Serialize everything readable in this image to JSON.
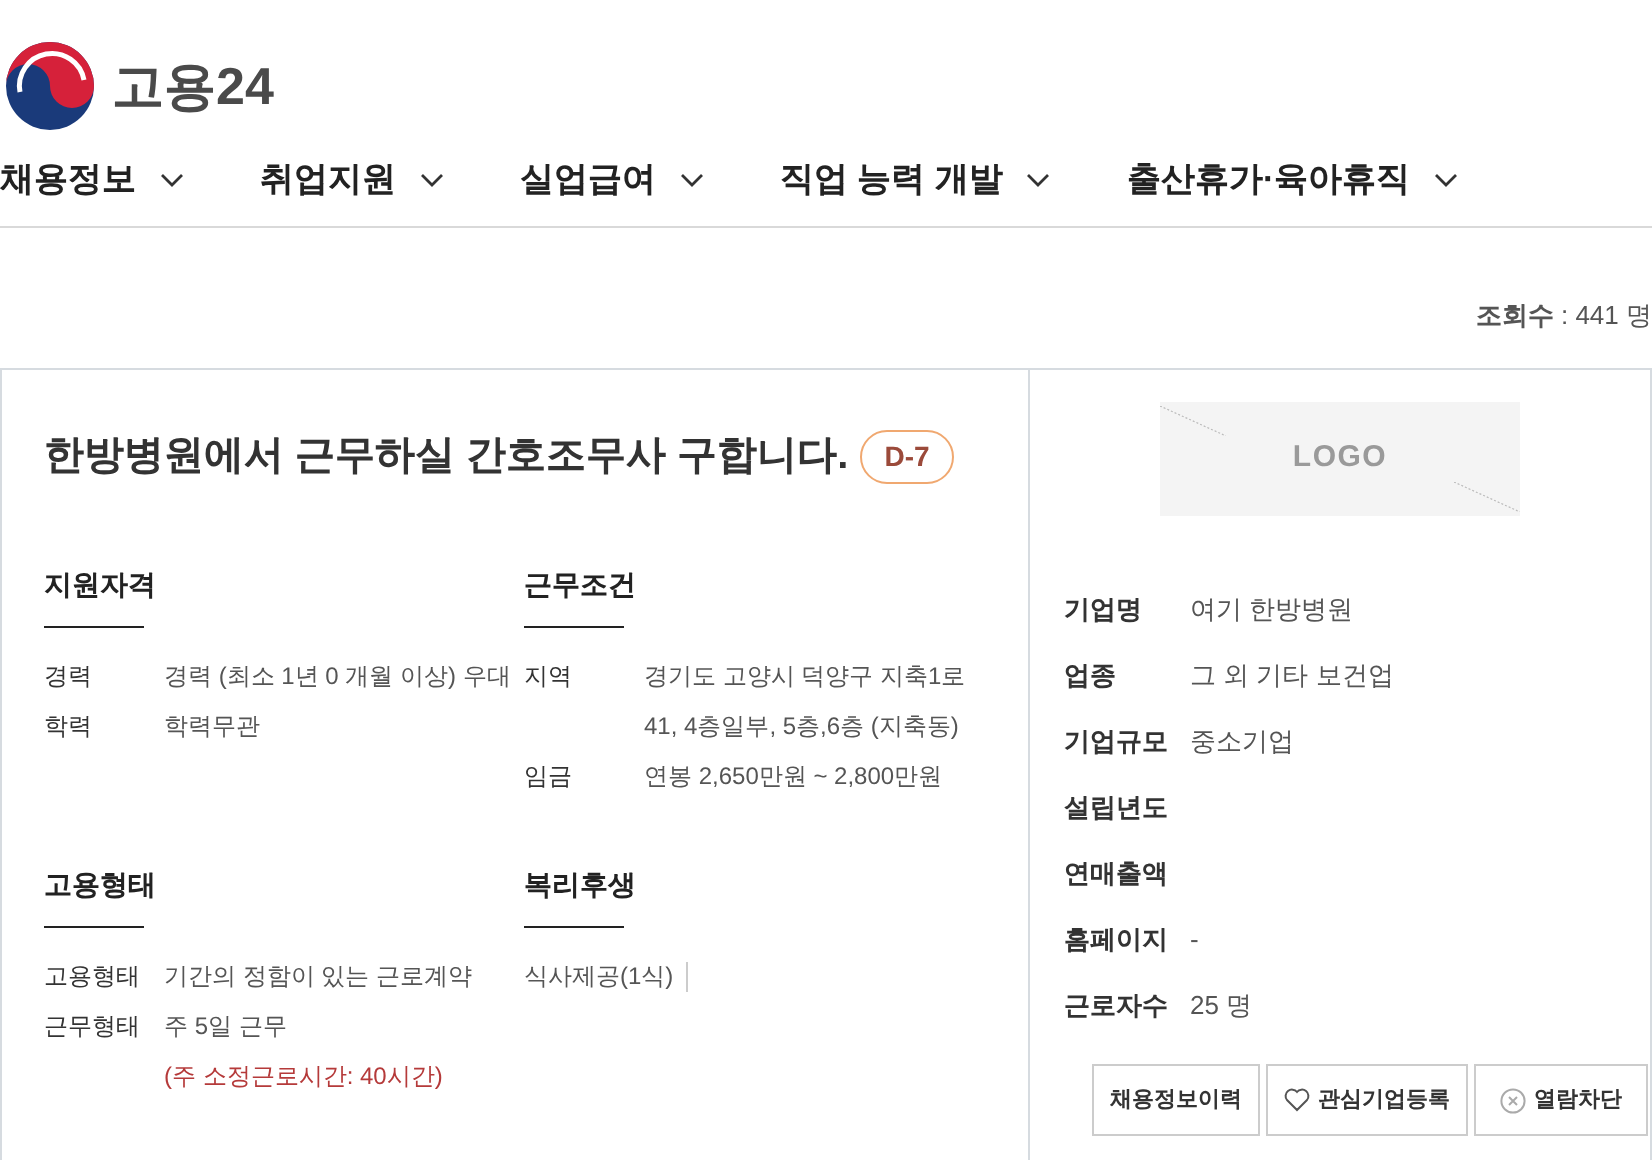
{
  "site": {
    "title": "고용24"
  },
  "nav": [
    {
      "label": "채용정보"
    },
    {
      "label": "취업지원"
    },
    {
      "label": "실업급여"
    },
    {
      "label": "직업 능력 개발"
    },
    {
      "label": "출산휴가·육아휴직"
    }
  ],
  "views": "**조회수** : 441 명",
  "posting": {
    "title": "한방병원에서 근무하실 간호조무사 구합니다.",
    "badge": "D-7",
    "sections": [
      {
        "heading": "지원자격",
        "rows": [
          {
            "kind": "pair",
            "label": "경력",
            "value": "경력 (최소 1년 0 개월 이상) 우대"
          },
          {
            "kind": "pair",
            "label": "학력",
            "value": "학력무관"
          }
        ]
      },
      {
        "heading": "근무조건",
        "rows": [
          {
            "kind": "pair",
            "label": "지역",
            "value": "경기도 고양시 덕양구 지축1로 41, 4층일부, 5층,6층 (지축동)"
          },
          {
            "kind": "pair",
            "label": "임금",
            "value": "연봉 2,650만원 ~ 2,800만원"
          }
        ]
      },
      {
        "heading": "고용형태",
        "rows": [
          {
            "kind": "pair",
            "label": "고용형태",
            "value": "기간의 정함이 있는 근로계약"
          },
          {
            "kind": "pair",
            "label": "근무형태",
            "value": "주 5일 근무"
          },
          {
            "kind": "note",
            "value": "(주 소정근로시간: 40시간)"
          }
        ]
      },
      {
        "heading": "복리후생",
        "rows": [
          {
            "kind": "tags",
            "values": [
              "식사제공(1식)"
            ]
          }
        ]
      }
    ]
  },
  "company": {
    "logo_text": "LOGO",
    "rows": [
      {
        "label": "기업명",
        "value": "여기 한방병원"
      },
      {
        "label": "업종",
        "value": "그 외 기타 보건업"
      },
      {
        "label": "기업규모",
        "value": "중소기업"
      },
      {
        "label": "설립년도"
      },
      {
        "label": "연매출액"
      },
      {
        "label": "홈페이지",
        "value": "-"
      },
      {
        "label": "근로자수",
        "value": "25 명"
      }
    ],
    "buttons": [
      {
        "kind": "plain",
        "label": "채용정보이력"
      },
      {
        "kind": "heart",
        "label": "관심기업등록"
      },
      {
        "kind": "block",
        "label": "열람차단"
      }
    ]
  }
}
